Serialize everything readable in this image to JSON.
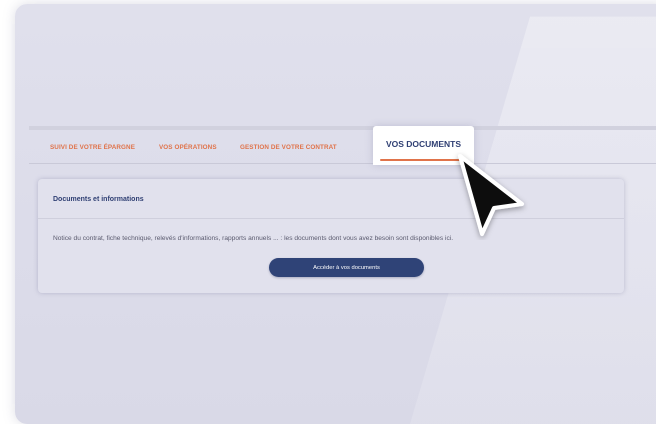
{
  "tabs": {
    "suivi": "SUIVI DE VOTRE ÉPARGNE",
    "operations": "VOS OPÉRATIONS",
    "gestion": "GESTION DE VOTRE CONTRAT",
    "documents": "VOS DOCUMENTS"
  },
  "card": {
    "title": "Documents et informations",
    "description": "Notice du contrat, fiche technique, relevés d'informations, rapports annuels ... : les documents dont vous avez besoin sont disponibles ici.",
    "button_label": "Accéder à vos documents"
  },
  "colors": {
    "accent_orange": "#e0734a",
    "primary_navy": "#2f4377"
  },
  "icons": {
    "cursor": "mouse-pointer-icon"
  }
}
